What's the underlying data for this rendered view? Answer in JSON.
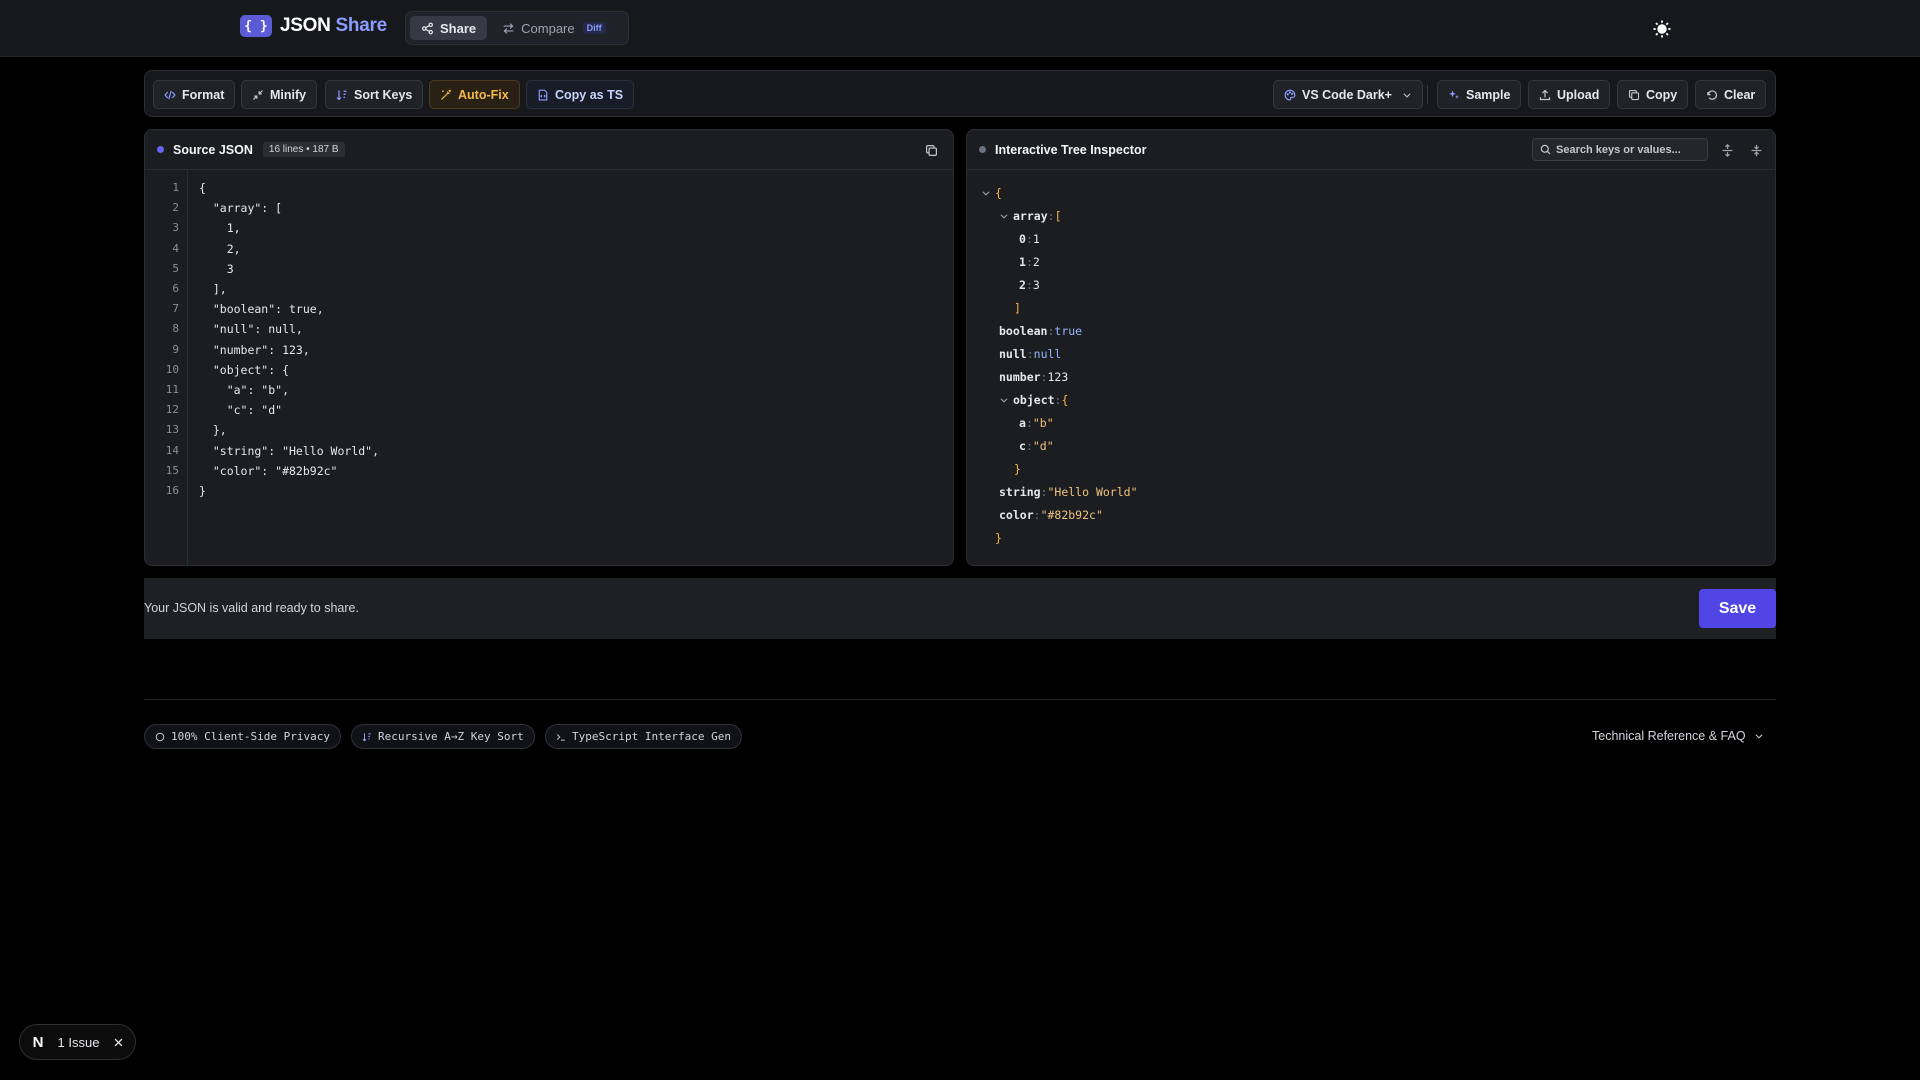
{
  "header": {
    "logo_mark": "{ }",
    "logo_word": "JSON",
    "logo_accent": "Share",
    "nav": [
      {
        "label": "Share",
        "icon": "share-icon",
        "active": true
      },
      {
        "label": "Compare",
        "icon": "compare-icon",
        "badge": "Diff",
        "active": false
      }
    ],
    "theme_icon": "sun-icon"
  },
  "toolbar": {
    "format": "Format",
    "minify": "Minify",
    "sort_keys": "Sort Keys",
    "auto_fix": "Auto-Fix",
    "copy_as_ts": "Copy as TS",
    "theme_select": "VS Code Dark+",
    "sample": "Sample",
    "upload": "Upload",
    "copy": "Copy",
    "clear": "Clear"
  },
  "source_panel": {
    "title": "Source JSON",
    "meta": "16 lines • 187 B",
    "dot_color": "#6366f1",
    "lines": [
      "{",
      "  \"array\": [",
      "    1,",
      "    2,",
      "    3",
      "  ],",
      "  \"boolean\": true,",
      "  \"null\": null,",
      "  \"number\": 123,",
      "  \"object\": {",
      "    \"a\": \"b\",",
      "    \"c\": \"d\"",
      "  },",
      "  \"string\": \"Hello World\",",
      "  \"color\": \"#82b92c\"",
      "}"
    ],
    "line_numbers": [
      "1",
      "2",
      "3",
      "4",
      "5",
      "6",
      "7",
      "8",
      "9",
      "10",
      "11",
      "12",
      "13",
      "14",
      "15",
      "16"
    ]
  },
  "tree_panel": {
    "title": "Interactive Tree Inspector",
    "dot_color": "#6366f1",
    "search_placeholder": "Search keys or values...",
    "nodes": {
      "root_open": "{",
      "array_key": "array",
      "array_open": "[",
      "i0": "0",
      "v0": "1",
      "i1": "1",
      "v1": "2",
      "i2": "2",
      "v2": "3",
      "array_close": "]",
      "boolean_key": "boolean",
      "boolean_val": "true",
      "null_key": "null",
      "null_val": "null",
      "number_key": "number",
      "number_val": "123",
      "object_key": "object",
      "object_open": "{",
      "a_key": "a",
      "a_val": "\"b\"",
      "c_key": "c",
      "c_val": "\"d\"",
      "object_close": "}",
      "string_key": "string",
      "string_val": "\"Hello World\"",
      "color_key": "color",
      "color_val": "\"#82b92c\"",
      "root_close": "}",
      "colon": ":"
    }
  },
  "status": {
    "message": "Your JSON is valid and ready to share.",
    "save": "Save"
  },
  "footer": {
    "chips": [
      "100% Client-Side Privacy",
      "Recursive A→Z Key Sort",
      "TypeScript Interface Gen"
    ],
    "faq": "Technical Reference & FAQ"
  },
  "issue_pill": {
    "logo": "N",
    "label": "1 Issue"
  },
  "colors": {
    "accent": "#4f46e5",
    "auto_fix": "#f5b94b"
  }
}
